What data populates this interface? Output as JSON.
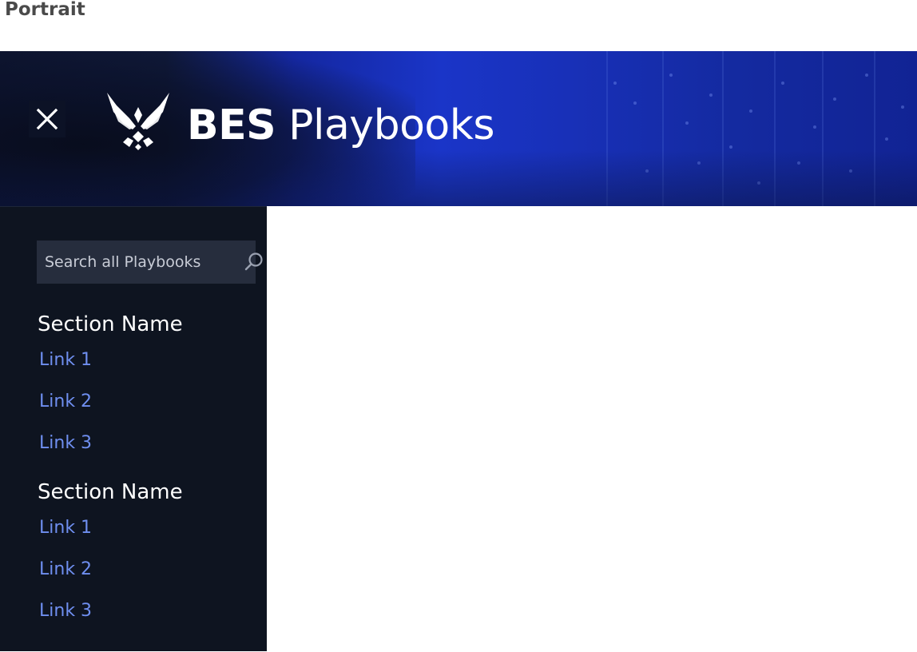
{
  "page_label": "Portrait",
  "header": {
    "close_icon": "close-icon",
    "logo_icon": "air-force-wings-logo",
    "brand_strong": "BES",
    "brand_light": "Playbooks"
  },
  "search": {
    "placeholder": "Search all Playbooks",
    "icon": "search-icon"
  },
  "sections": [
    {
      "title": "Section Name",
      "links": [
        "Link 1",
        "Link 2",
        "Link 3"
      ]
    },
    {
      "title": "Section Name",
      "links": [
        "Link 1",
        "Link 2",
        "Link 3"
      ]
    }
  ],
  "colors": {
    "sidebar_bg": "#0e1420",
    "search_bg": "#262d3d",
    "link": "#6f8ff0",
    "header_blue": "#1a35c8"
  }
}
